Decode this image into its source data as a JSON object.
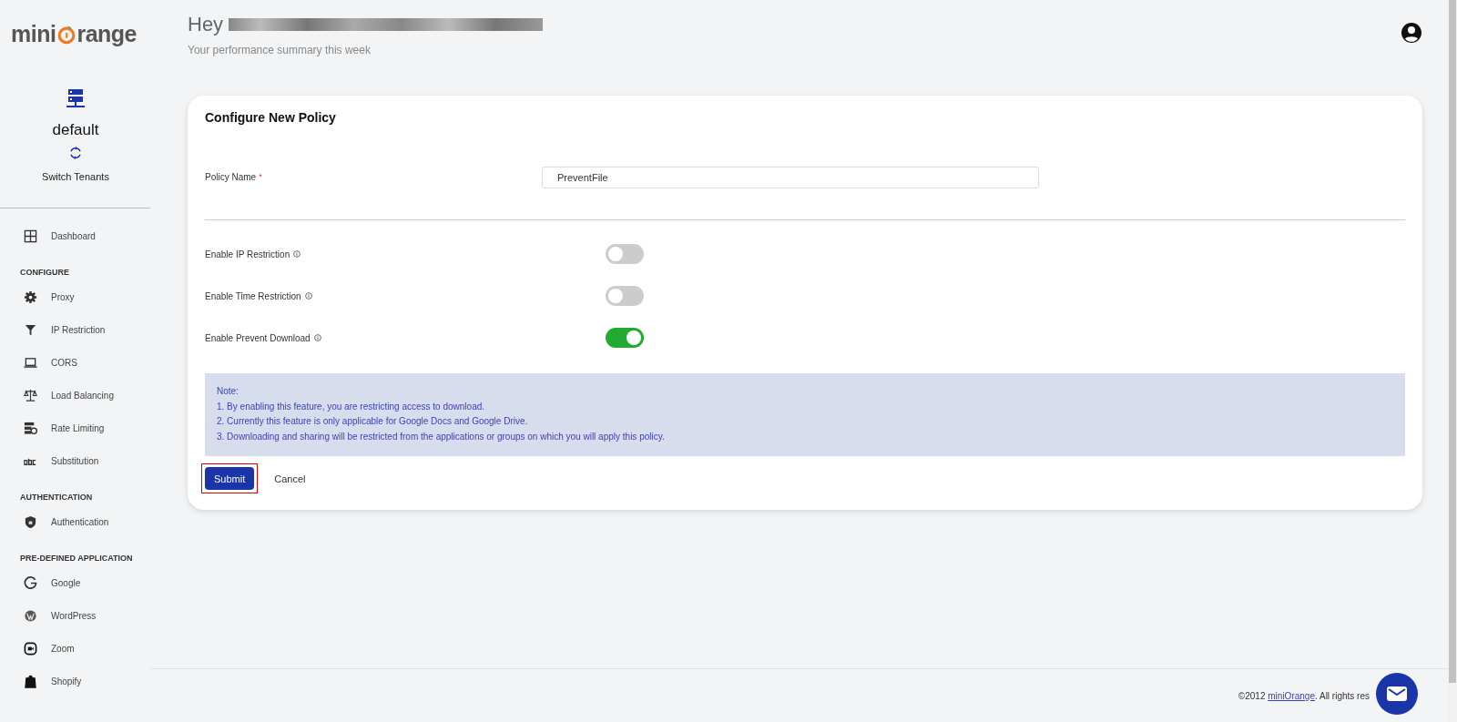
{
  "logo": {
    "before": "mini",
    "after": "range"
  },
  "tenant": {
    "name": "default",
    "switch_label": "Switch Tenants"
  },
  "sidebar": [
    {
      "items": [
        {
          "label": "Dashboard",
          "selected": false
        }
      ]
    },
    {
      "heading": "CONFIGURE",
      "items": [
        {
          "label": "Proxy",
          "selected": false
        },
        {
          "label": "IP Restriction",
          "selected": false
        },
        {
          "label": "CORS",
          "selected": false
        },
        {
          "label": "Load Balancing",
          "selected": false
        },
        {
          "label": "Rate Limiting",
          "selected": false
        },
        {
          "label": "Substitution",
          "selected": false
        }
      ]
    },
    {
      "heading": "AUTHENTICATION",
      "items": [
        {
          "label": "Authentication",
          "selected": false
        }
      ]
    },
    {
      "heading": "PRE-DEFINED APPLICATION",
      "items": [
        {
          "label": "Google",
          "selected": false
        },
        {
          "label": "WordPress",
          "selected": false
        },
        {
          "label": "Zoom",
          "selected": false
        },
        {
          "label": "Shopify",
          "selected": false
        }
      ]
    }
  ],
  "header": {
    "greeting": "Hey",
    "subtitle": "Your performance summary this week"
  },
  "card": {
    "title": "Configure New Policy",
    "policy_name": {
      "label": "Policy Name",
      "required_mark": "*",
      "value": "PreventFile"
    },
    "toggles": [
      {
        "label": "Enable IP Restriction",
        "on": false
      },
      {
        "label": "Enable Time Restriction",
        "on": false
      },
      {
        "label": "Enable Prevent Download",
        "on": true
      }
    ],
    "note": [
      "Note:",
      "1. By enabling this feature, you are restricting access to download.",
      "2. Currently this feature is only applicable for Google Docs and Google Drive.",
      "3. Downloading and sharing will be restricted from the applications or groups on which you will apply this policy."
    ],
    "buttons": [
      {
        "label": "Submit",
        "kind": "primary",
        "highlighted": true
      },
      {
        "label": "Cancel",
        "kind": "plain",
        "highlighted": false
      }
    ]
  },
  "footer": {
    "prefix": "©2012",
    "link": "miniOrange",
    "suffix": ". All rights res"
  }
}
